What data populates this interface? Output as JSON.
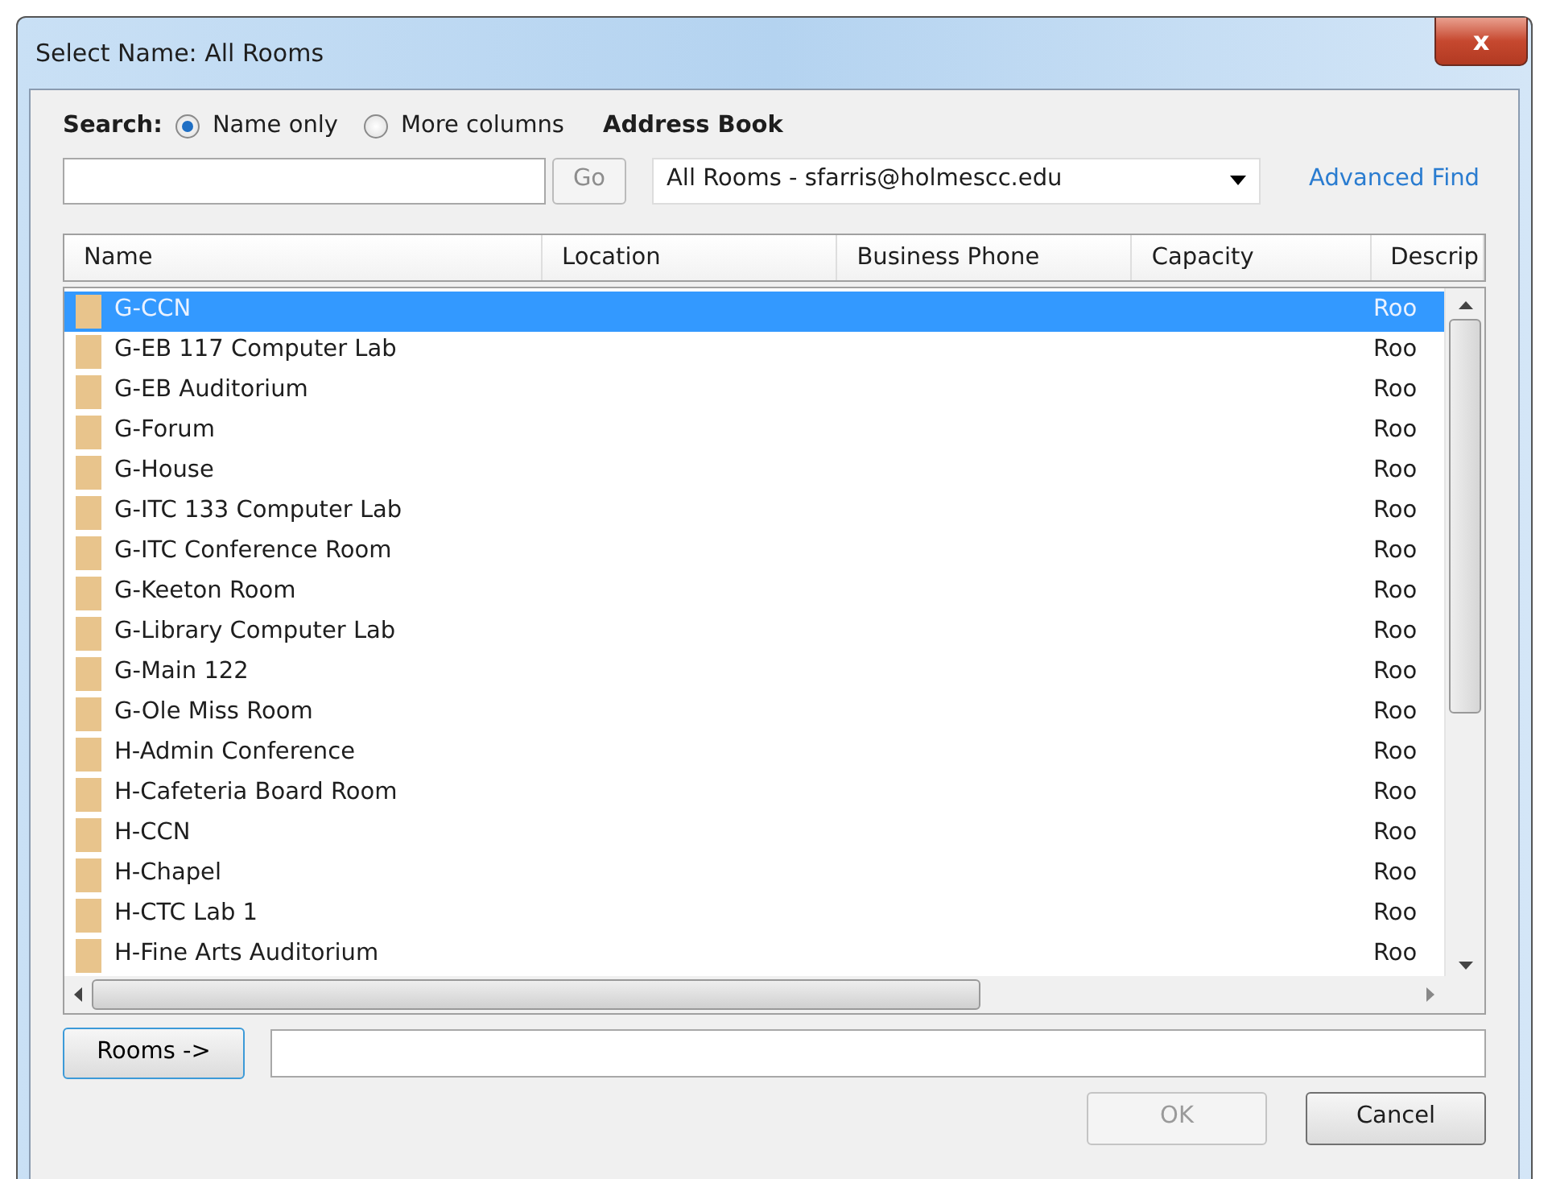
{
  "window": {
    "title": "Select Name: All Rooms",
    "close": "x"
  },
  "search": {
    "label": "Search:",
    "options": [
      {
        "label": "Name only",
        "selected": true
      },
      {
        "label": "More columns",
        "selected": false
      }
    ],
    "go": {
      "label": "Go",
      "disabled": true
    }
  },
  "address_book": {
    "label": "Address Book",
    "value": "All Rooms - sfarris@holmescc.edu",
    "advanced_find": "Advanced Find"
  },
  "table": {
    "columns": [
      "Name",
      "Location",
      "Business Phone",
      "Capacity",
      "Descrip"
    ],
    "rows": [
      {
        "name": "G-CCN",
        "description": "Roo",
        "selected": true
      },
      {
        "name": "G-EB 117 Computer Lab",
        "description": "Roo",
        "selected": false
      },
      {
        "name": "G-EB Auditorium",
        "description": "Roo",
        "selected": false
      },
      {
        "name": "G-Forum",
        "description": "Roo",
        "selected": false
      },
      {
        "name": "G-House",
        "description": "Roo",
        "selected": false
      },
      {
        "name": "G-ITC 133 Computer Lab",
        "description": "Roo",
        "selected": false
      },
      {
        "name": "G-ITC Conference Room",
        "description": "Roo",
        "selected": false
      },
      {
        "name": "G-Keeton Room",
        "description": "Roo",
        "selected": false
      },
      {
        "name": "G-Library Computer Lab",
        "description": "Roo",
        "selected": false
      },
      {
        "name": "G-Main 122",
        "description": "Roo",
        "selected": false
      },
      {
        "name": "G-Ole Miss Room",
        "description": "Roo",
        "selected": false
      },
      {
        "name": "H-Admin Conference",
        "description": "Roo",
        "selected": false
      },
      {
        "name": "H-Cafeteria Board Room",
        "description": "Roo",
        "selected": false
      },
      {
        "name": "H-CCN",
        "description": "Roo",
        "selected": false
      },
      {
        "name": "H-Chapel",
        "description": "Roo",
        "selected": false
      },
      {
        "name": "H-CTC Lab 1",
        "description": "Roo",
        "selected": false
      },
      {
        "name": "H-Fine Arts Auditorium",
        "description": "Roo",
        "selected": false
      }
    ]
  },
  "rooms_button": "Rooms ->",
  "buttons": [
    {
      "label": "OK",
      "disabled": true
    },
    {
      "label": "Cancel",
      "disabled": false
    }
  ]
}
